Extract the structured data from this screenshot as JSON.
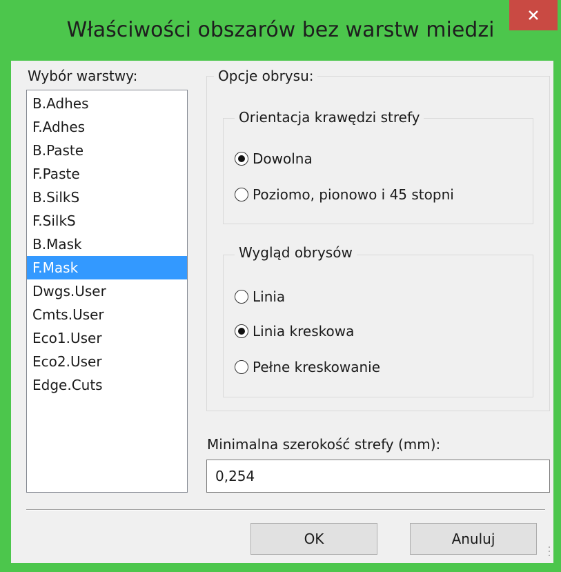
{
  "window": {
    "title": "Właściwości obszarów bez warstw miedzi",
    "close_icon": "close-icon",
    "accent_color": "#4cc64c",
    "close_color": "#c94a43"
  },
  "layers": {
    "label": "Wybór warstwy:",
    "items": [
      "B.Adhes",
      "F.Adhes",
      "B.Paste",
      "F.Paste",
      "B.SilkS",
      "F.SilkS",
      "B.Mask",
      "F.Mask",
      "Dwgs.User",
      "Cmts.User",
      "Eco1.User",
      "Eco2.User",
      "Edge.Cuts"
    ],
    "selected": "F.Mask"
  },
  "outline": {
    "title": "Opcje obrysu:",
    "orientation": {
      "title": "Orientacja krawędzi strefy",
      "options": [
        "Dowolna",
        "Poziomo, pionowo i 45 stopni"
      ],
      "selected": "Dowolna"
    },
    "appearance": {
      "title": "Wygląd obrysów",
      "options": [
        "Linia",
        "Linia kreskowa",
        "Pełne kreskowanie"
      ],
      "selected": "Linia kreskowa"
    }
  },
  "min_width": {
    "label": "Minimalna szerokość strefy (mm):",
    "value": "0,254"
  },
  "buttons": {
    "ok": "OK",
    "cancel": "Anuluj"
  }
}
